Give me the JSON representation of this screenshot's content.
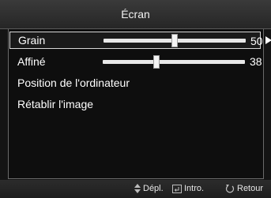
{
  "window": {
    "title": "Écran"
  },
  "menu": {
    "items": [
      {
        "label": "Grain",
        "value": "50",
        "level": 0.5,
        "selected": true
      },
      {
        "label": "Affiné",
        "value": "38",
        "level": 0.38,
        "selected": false
      },
      {
        "label": "Position de l'ordinateur"
      },
      {
        "label": "Rétablir l'image"
      }
    ]
  },
  "footer": {
    "move_label": "Dépl.",
    "enter_label": "Intro.",
    "return_label": "Retour",
    "move_icon": "up-down-arrows-icon",
    "enter_icon": "enter-icon",
    "return_icon": "return-icon"
  },
  "colors": {
    "background": "#141414",
    "text": "#ffffff",
    "selection_border": "#d8d8d8"
  }
}
